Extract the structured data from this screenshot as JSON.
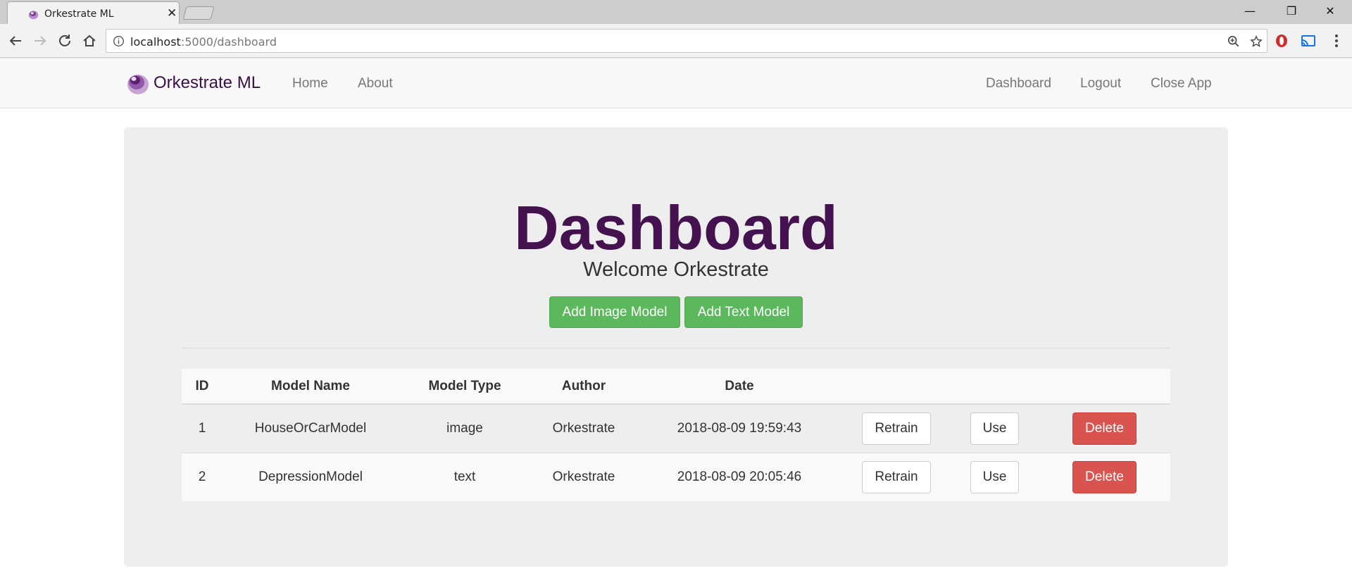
{
  "browser": {
    "tab_title": "Orkestrate ML",
    "tab_close": "✕",
    "url_host": "localhost",
    "url_path": ":5000/dashboard",
    "window_controls": {
      "minimize": "—",
      "restore": "❐",
      "close": "✕"
    }
  },
  "navbar": {
    "brand": "Orkestrate ML",
    "left_links": [
      "Home",
      "About"
    ],
    "right_links": [
      "Dashboard",
      "Logout",
      "Close App"
    ]
  },
  "page": {
    "title": "Dashboard",
    "welcome": "Welcome Orkestrate",
    "add_image_label": "Add Image Model",
    "add_text_label": "Add Text Model"
  },
  "table": {
    "headers": [
      "ID",
      "Model Name",
      "Model Type",
      "Author",
      "Date"
    ],
    "rows": [
      {
        "id": "1",
        "name": "HouseOrCarModel",
        "type": "image",
        "author": "Orkestrate",
        "date": "2018-08-09 19:59:43"
      },
      {
        "id": "2",
        "name": "DepressionModel",
        "type": "text",
        "author": "Orkestrate",
        "date": "2018-08-09 20:05:46"
      }
    ],
    "retrain_label": "Retrain",
    "use_label": "Use",
    "delete_label": "Delete"
  },
  "colors": {
    "brand_purple": "#43124f",
    "success_green": "#5cb85c",
    "danger_red": "#d9534f"
  }
}
